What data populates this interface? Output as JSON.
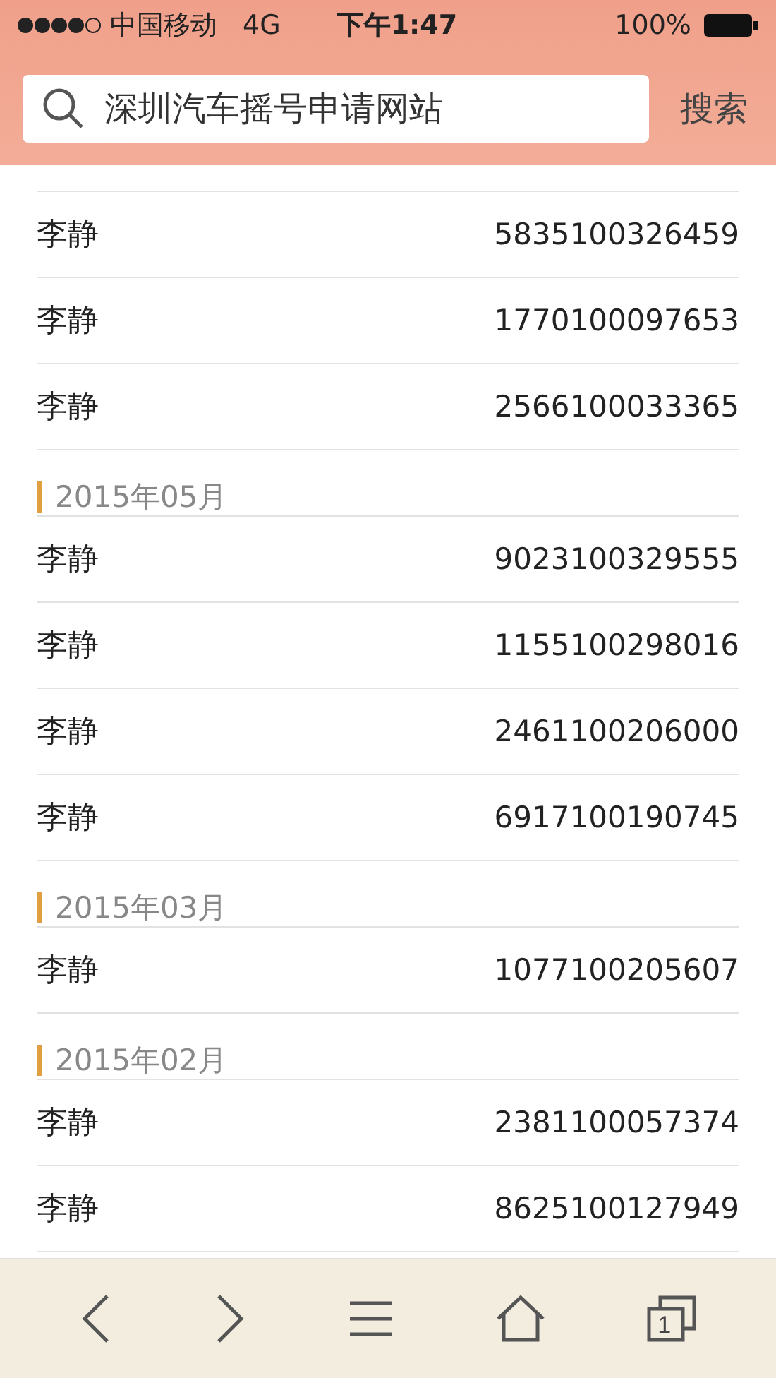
{
  "status_bar": {
    "carrier": "中国移动",
    "network": "4G",
    "time": "下午1:47",
    "battery": "100%"
  },
  "search": {
    "value": "深圳汽车摇号申请网站",
    "button": "搜索"
  },
  "groups": [
    {
      "rows": [
        {
          "name": "李静",
          "number": "5835100326459"
        },
        {
          "name": "李静",
          "number": "1770100097653"
        },
        {
          "name": "李静",
          "number": "2566100033365"
        }
      ]
    },
    {
      "header": "2015年05月",
      "rows": [
        {
          "name": "李静",
          "number": "9023100329555"
        },
        {
          "name": "李静",
          "number": "1155100298016"
        },
        {
          "name": "李静",
          "number": "2461100206000"
        },
        {
          "name": "李静",
          "number": "6917100190745"
        }
      ]
    },
    {
      "header": "2015年03月",
      "rows": [
        {
          "name": "李静",
          "number": "1077100205607"
        }
      ]
    },
    {
      "header": "2015年02月",
      "rows": [
        {
          "name": "李静",
          "number": "2381100057374"
        },
        {
          "name": "李静",
          "number": "8625100127949"
        }
      ]
    }
  ],
  "toolbar": {
    "tab_count": "1"
  }
}
